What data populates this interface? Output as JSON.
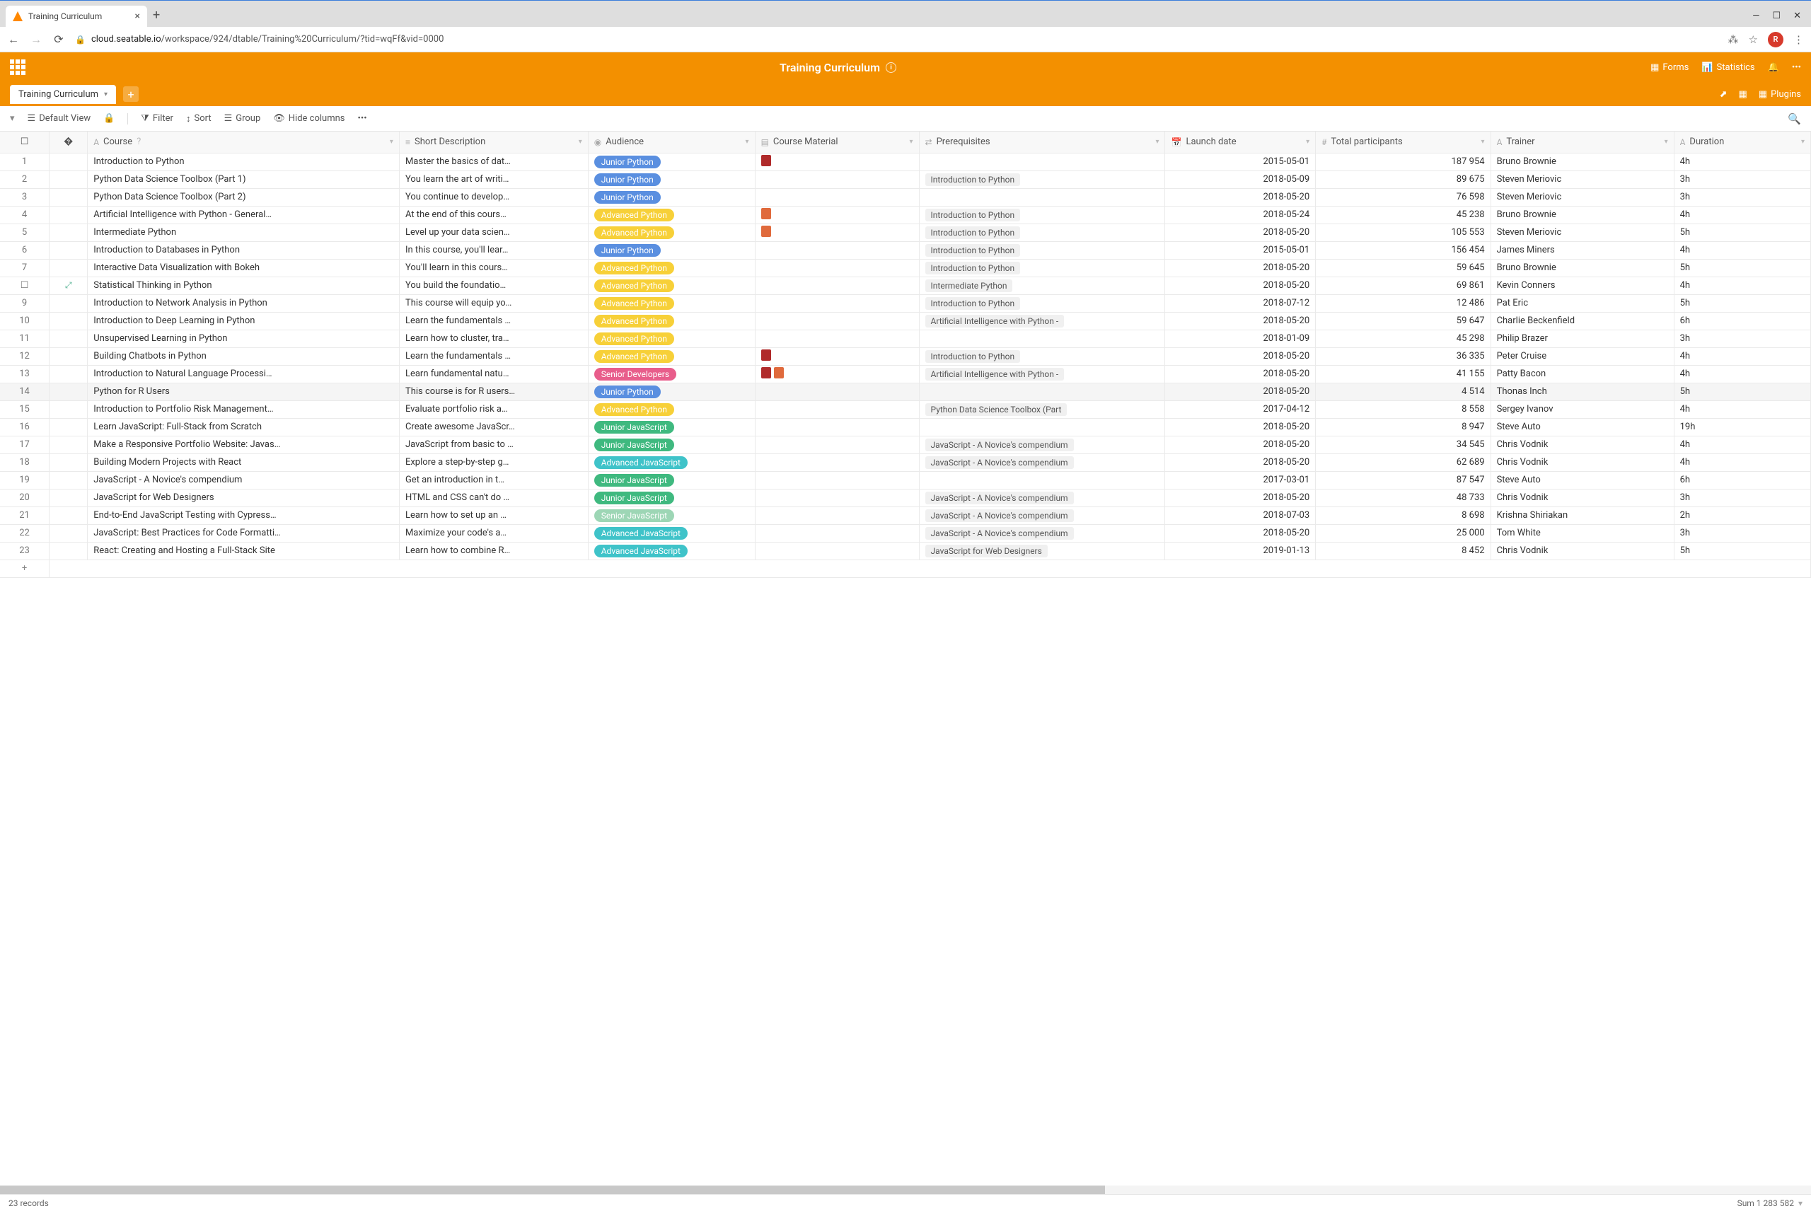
{
  "browser": {
    "tab_title": "Training Curriculum",
    "url_host": "cloud.seatable.io",
    "url_path": "/workspace/924/dtable/Training%20Curriculum/?tid=wqFf&vid=0000",
    "avatar_letter": "R"
  },
  "header": {
    "title": "Training Curriculum",
    "forms": "Forms",
    "statistics": "Statistics",
    "plugins": "Plugins"
  },
  "table_tab": "Training Curriculum",
  "toolbar": {
    "view": "Default View",
    "filter": "Filter",
    "sort": "Sort",
    "group": "Group",
    "hide": "Hide columns"
  },
  "columns": {
    "course": "Course",
    "desc": "Short Description",
    "audience": "Audience",
    "material": "Course Material",
    "prereq": "Prerequisites",
    "launch": "Launch date",
    "participants": "Total participants",
    "trainer": "Trainer",
    "duration": "Duration"
  },
  "rows": [
    {
      "n": 1,
      "course": "Introduction to Python",
      "desc": "Master the basics of dat…",
      "aud": "Junior Python",
      "mat": [
        "pdf"
      ],
      "pre": "",
      "date": "2015-05-01",
      "part": "187 954",
      "trainer": "Bruno Brownie",
      "dur": "4h"
    },
    {
      "n": 2,
      "course": "Python Data Science Toolbox (Part 1)",
      "desc": "You learn the art of writi…",
      "aud": "Junior Python",
      "mat": [],
      "pre": "Introduction to Python",
      "date": "2018-05-09",
      "part": "89 675",
      "trainer": "Steven Meriovic",
      "dur": "3h"
    },
    {
      "n": 3,
      "course": "Python Data Science Toolbox (Part 2)",
      "desc": "You continue to develop…",
      "aud": "Junior Python",
      "mat": [],
      "pre": "",
      "date": "2018-05-20",
      "part": "76 598",
      "trainer": "Steven Meriovic",
      "dur": "3h"
    },
    {
      "n": 4,
      "course": "Artificial Intelligence with Python - General…",
      "desc": "At the end of this cours…",
      "aud": "Advanced Python",
      "mat": [
        "img"
      ],
      "pre": "Introduction to Python",
      "date": "2018-05-24",
      "part": "45 238",
      "trainer": "Bruno Brownie",
      "dur": "4h"
    },
    {
      "n": 5,
      "course": "Intermediate Python",
      "desc": "Level up your data scien…",
      "aud": "Advanced Python",
      "mat": [
        "img"
      ],
      "pre": "Introduction to Python",
      "date": "2018-05-20",
      "part": "105 553",
      "trainer": "Steven Meriovic",
      "dur": "5h"
    },
    {
      "n": 6,
      "course": "Introduction to Databases in Python",
      "desc": "In this course, you'll lear…",
      "aud": "Junior Python",
      "mat": [],
      "pre": "Introduction to Python",
      "date": "2015-05-01",
      "part": "156 454",
      "trainer": "James Miners",
      "dur": "4h"
    },
    {
      "n": 7,
      "course": "Interactive Data Visualization with Bokeh",
      "desc": "You'll learn in this cours…",
      "aud": "Advanced Python",
      "mat": [],
      "pre": "Introduction to Python",
      "date": "2018-05-20",
      "part": "59 645",
      "trainer": "Bruno Brownie",
      "dur": "5h"
    },
    {
      "n": 8,
      "course": "Statistical Thinking in Python",
      "desc": "You build the foundatio…",
      "aud": "Advanced Python",
      "mat": [],
      "pre": "Intermediate Python",
      "date": "2018-05-20",
      "part": "69 861",
      "trainer": "Kevin Conners",
      "dur": "4h",
      "active": true
    },
    {
      "n": 9,
      "course": "Introduction to Network Analysis in Python",
      "desc": "This course will equip yo…",
      "aud": "Advanced Python",
      "mat": [],
      "pre": "Introduction to Python",
      "date": "2018-07-12",
      "part": "12 486",
      "trainer": "Pat Eric",
      "dur": "5h"
    },
    {
      "n": 10,
      "course": "Introduction to Deep Learning in Python",
      "desc": "Learn the fundamentals …",
      "aud": "Advanced Python",
      "mat": [],
      "pre": "Artificial Intelligence with Python -",
      "date": "2018-05-20",
      "part": "59 647",
      "trainer": "Charlie Beckenfield",
      "dur": "6h"
    },
    {
      "n": 11,
      "course": "Unsupervised Learning in Python",
      "desc": "Learn how to cluster, tra…",
      "aud": "Advanced Python",
      "mat": [],
      "pre": "",
      "date": "2018-01-09",
      "part": "45 298",
      "trainer": "Philip Brazer",
      "dur": "3h"
    },
    {
      "n": 12,
      "course": "Building Chatbots in Python",
      "desc": "Learn the fundamentals …",
      "aud": "Advanced Python",
      "mat": [
        "pdf"
      ],
      "pre": "Introduction to Python",
      "date": "2018-05-20",
      "part": "36 335",
      "trainer": "Peter Cruise",
      "dur": "4h"
    },
    {
      "n": 13,
      "course": "Introduction to Natural Language Processi…",
      "desc": "Learn fundamental natu…",
      "aud": "Senior Developers",
      "mat": [
        "pdf",
        "img"
      ],
      "pre": "Artificial Intelligence with Python -",
      "date": "2018-05-20",
      "part": "41 155",
      "trainer": "Patty Bacon",
      "dur": "4h"
    },
    {
      "n": 14,
      "course": "Python for R Users",
      "desc": "This course is for R users…",
      "aud": "Junior Python",
      "mat": [],
      "pre": "",
      "date": "2018-05-20",
      "part": "4 514",
      "trainer": "Thonas Inch",
      "dur": "5h",
      "hover": true
    },
    {
      "n": 15,
      "course": "Introduction to Portfolio Risk Management…",
      "desc": "Evaluate portfolio risk a…",
      "aud": "Advanced Python",
      "mat": [],
      "pre": "Python Data Science Toolbox (Part",
      "date": "2017-04-12",
      "part": "8 558",
      "trainer": "Sergey Ivanov",
      "dur": "4h"
    },
    {
      "n": 16,
      "course": "Learn JavaScript: Full-Stack from Scratch",
      "desc": "Create awesome JavaScr…",
      "aud": "Junior JavaScript",
      "mat": [],
      "pre": "",
      "date": "2018-05-20",
      "part": "8 947",
      "trainer": "Steve Auto",
      "dur": "19h"
    },
    {
      "n": 17,
      "course": "Make a Responsive Portfolio Website: Javas…",
      "desc": "JavaScript from basic to …",
      "aud": "Junior JavaScript",
      "mat": [],
      "pre": "JavaScript - A Novice's compendium",
      "date": "2018-05-20",
      "part": "34 545",
      "trainer": "Chris Vodnik",
      "dur": "4h"
    },
    {
      "n": 18,
      "course": "Building Modern Projects with React",
      "desc": "Explore a step-by-step g…",
      "aud": "Advanced JavaScript",
      "mat": [],
      "pre": "JavaScript - A Novice's compendium",
      "date": "2018-05-20",
      "part": "62 689",
      "trainer": "Chris Vodnik",
      "dur": "4h"
    },
    {
      "n": 19,
      "course": "JavaScript - A Novice's compendium",
      "desc": "Get an introduction in t…",
      "aud": "Junior JavaScript",
      "mat": [],
      "pre": "",
      "date": "2017-03-01",
      "part": "87 547",
      "trainer": "Steve Auto",
      "dur": "6h"
    },
    {
      "n": 20,
      "course": "JavaScript for Web Designers",
      "desc": "HTML and CSS can't do …",
      "aud": "Junior JavaScript",
      "mat": [],
      "pre": "JavaScript - A Novice's compendium",
      "date": "2018-05-20",
      "part": "48 733",
      "trainer": "Chris Vodnik",
      "dur": "3h"
    },
    {
      "n": 21,
      "course": "End-to-End JavaScript Testing with Cypress…",
      "desc": "Learn how to set up an …",
      "aud": "Senior JavaScript",
      "mat": [],
      "pre": "JavaScript - A Novice's compendium",
      "date": "2018-07-03",
      "part": "8 698",
      "trainer": "Krishna Shiriakan",
      "dur": "2h"
    },
    {
      "n": 22,
      "course": "JavaScript: Best Practices for Code Formatti…",
      "desc": "Maximize your code's a…",
      "aud": "Advanced JavaScript",
      "mat": [],
      "pre": "JavaScript - A Novice's compendium",
      "date": "2018-05-20",
      "part": "25 000",
      "trainer": "Tom White",
      "dur": "3h"
    },
    {
      "n": 23,
      "course": "React: Creating and Hosting a Full-Stack Site",
      "desc": "Learn how to combine R…",
      "aud": "Advanced JavaScript",
      "mat": [],
      "pre": "JavaScript for Web Designers",
      "date": "2019-01-13",
      "part": "8 452",
      "trainer": "Chris Vodnik",
      "dur": "5h"
    }
  ],
  "status": {
    "records": "23 records",
    "sum": "Sum 1 283 582"
  },
  "audience_class": {
    "Junior Python": "pill-junior-python",
    "Advanced Python": "pill-advanced-python",
    "Senior Developers": "pill-senior-developers",
    "Junior JavaScript": "pill-junior-javascript",
    "Advanced JavaScript": "pill-advanced-javascript",
    "Senior JavaScript": "pill-senior-javascript"
  }
}
